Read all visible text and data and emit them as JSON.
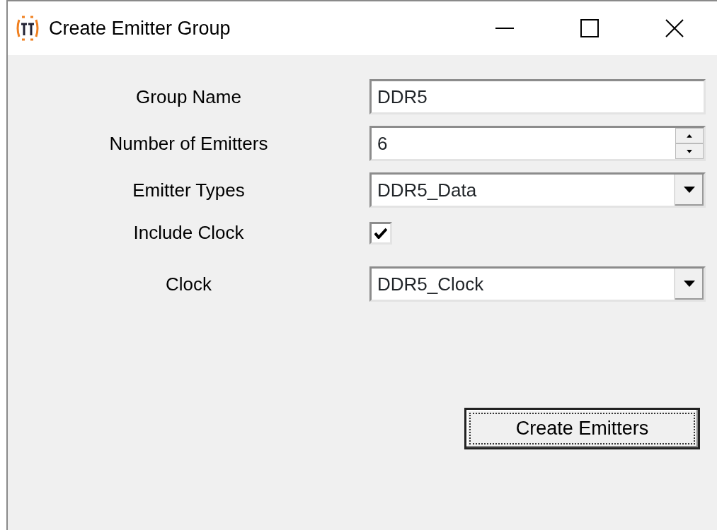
{
  "window": {
    "title": "Create Emitter Group"
  },
  "fields": [
    {
      "kind": "text",
      "label": "Group Name",
      "value": "DDR5"
    },
    {
      "kind": "spinner",
      "label": "Number of Emitters",
      "value": "6"
    },
    {
      "kind": "dropdown",
      "label": "Emitter Types",
      "value": "DDR5_Data"
    },
    {
      "kind": "checkbox",
      "label": "Include Clock",
      "checked": true
    },
    {
      "kind": "dropdown",
      "label": "Clock",
      "value": "DDR5_Clock"
    }
  ],
  "buttons": [
    {
      "label": "Create Emitters",
      "focused": true
    }
  ]
}
